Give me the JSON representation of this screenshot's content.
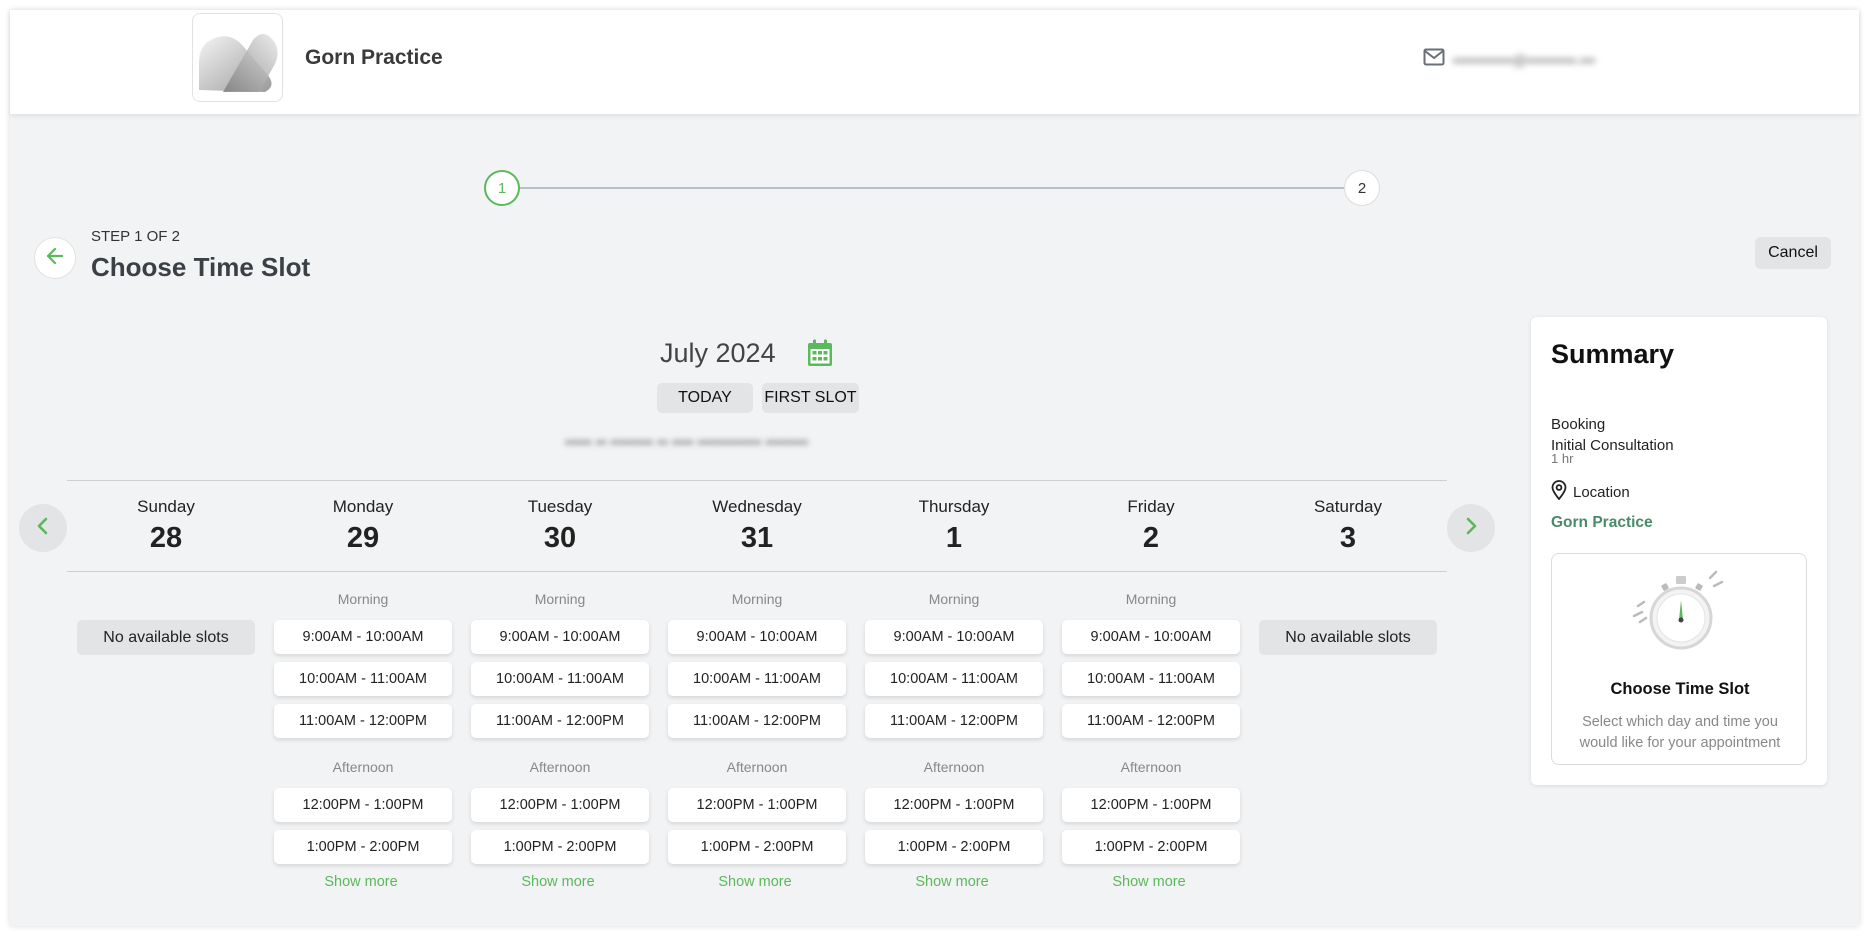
{
  "header": {
    "practice_name": "Gorn Practice",
    "email": "▪▪▪▪▪▪▪▪▪▪▪▪@▪▪▪▪▪▪▪▪▪▪.▪▪▪"
  },
  "stepper": {
    "steps": [
      "1",
      "2"
    ],
    "current": 1
  },
  "page": {
    "step_label": "STEP 1 OF 2",
    "title": "Choose Time Slot",
    "cancel_label": "Cancel"
  },
  "calendar": {
    "month": "July 2024",
    "today_label": "TODAY",
    "first_slot_label": "FIRST SLOT",
    "timezone_note": "▪▪▪▪▪ ▪▪ ▪▪▪▪▪▪▪▪ ▪▪ ▪▪▪▪ ▪▪▪▪▪▪▪▪▪▪▪▪ ▪▪▪▪▪▪▪▪"
  },
  "days": [
    {
      "name": "Sunday",
      "number": "28",
      "no_slots": "No available slots"
    },
    {
      "name": "Monday",
      "number": "29",
      "morning": "Morning",
      "afternoon": "Afternoon",
      "morning_slots": [
        "9:00AM - 10:00AM",
        "10:00AM - 11:00AM",
        "11:00AM - 12:00PM"
      ],
      "afternoon_slots": [
        "12:00PM - 1:00PM",
        "1:00PM - 2:00PM"
      ],
      "show_more": "Show more"
    },
    {
      "name": "Tuesday",
      "number": "30",
      "morning": "Morning",
      "afternoon": "Afternoon",
      "morning_slots": [
        "9:00AM - 10:00AM",
        "10:00AM - 11:00AM",
        "11:00AM - 12:00PM"
      ],
      "afternoon_slots": [
        "12:00PM - 1:00PM",
        "1:00PM - 2:00PM"
      ],
      "show_more": "Show more"
    },
    {
      "name": "Wednesday",
      "number": "31",
      "morning": "Morning",
      "afternoon": "Afternoon",
      "morning_slots": [
        "9:00AM - 10:00AM",
        "10:00AM - 11:00AM",
        "11:00AM - 12:00PM"
      ],
      "afternoon_slots": [
        "12:00PM - 1:00PM",
        "1:00PM - 2:00PM"
      ],
      "show_more": "Show more"
    },
    {
      "name": "Thursday",
      "number": "1",
      "morning": "Morning",
      "afternoon": "Afternoon",
      "morning_slots": [
        "9:00AM - 10:00AM",
        "10:00AM - 11:00AM",
        "11:00AM - 12:00PM"
      ],
      "afternoon_slots": [
        "12:00PM - 1:00PM",
        "1:00PM - 2:00PM"
      ],
      "show_more": "Show more"
    },
    {
      "name": "Friday",
      "number": "2",
      "morning": "Morning",
      "afternoon": "Afternoon",
      "morning_slots": [
        "9:00AM - 10:00AM",
        "10:00AM - 11:00AM",
        "11:00AM - 12:00PM"
      ],
      "afternoon_slots": [
        "12:00PM - 1:00PM",
        "1:00PM - 2:00PM"
      ],
      "show_more": "Show more"
    },
    {
      "name": "Saturday",
      "number": "3",
      "no_slots": "No available slots"
    }
  ],
  "summary": {
    "title": "Summary",
    "booking_label": "Booking",
    "service": "Initial Consultation",
    "duration": "1 hr",
    "location_label": "Location",
    "location_name": "Gorn Practice",
    "card_title": "Choose Time Slot",
    "card_text": "Select which day and time you would like for your appointment"
  },
  "colors": {
    "accent": "#5cb85c",
    "background": "#f2f3f4",
    "pill": "#e2e4e6"
  },
  "icons": [
    "mail-icon",
    "arrow-left-icon",
    "calendar-icon",
    "chevron-left-icon",
    "chevron-right-icon",
    "map-pin-icon",
    "stopwatch-icon"
  ]
}
